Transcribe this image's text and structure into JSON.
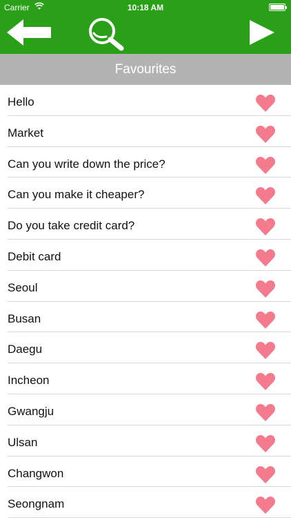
{
  "status_bar": {
    "carrier": "Carrier",
    "time": "10:18 AM"
  },
  "nav": {
    "back_icon": "back-arrow-icon",
    "search_icon": "search-icon",
    "next_icon": "play-next-icon"
  },
  "section": {
    "title": "Favourites"
  },
  "favourites": [
    "Hello",
    "Market",
    "Can you write down the price?",
    "Can you make it cheaper?",
    "Do you take credit card?",
    "Debit card",
    "Seoul",
    "Busan",
    "Daegu",
    "Incheon",
    "Gwangju",
    "Ulsan",
    "Changwon",
    "Seongnam"
  ],
  "colors": {
    "toolbar": "#2aa018",
    "section_header": "#b3b3b3",
    "heart": "#f47b8e"
  }
}
